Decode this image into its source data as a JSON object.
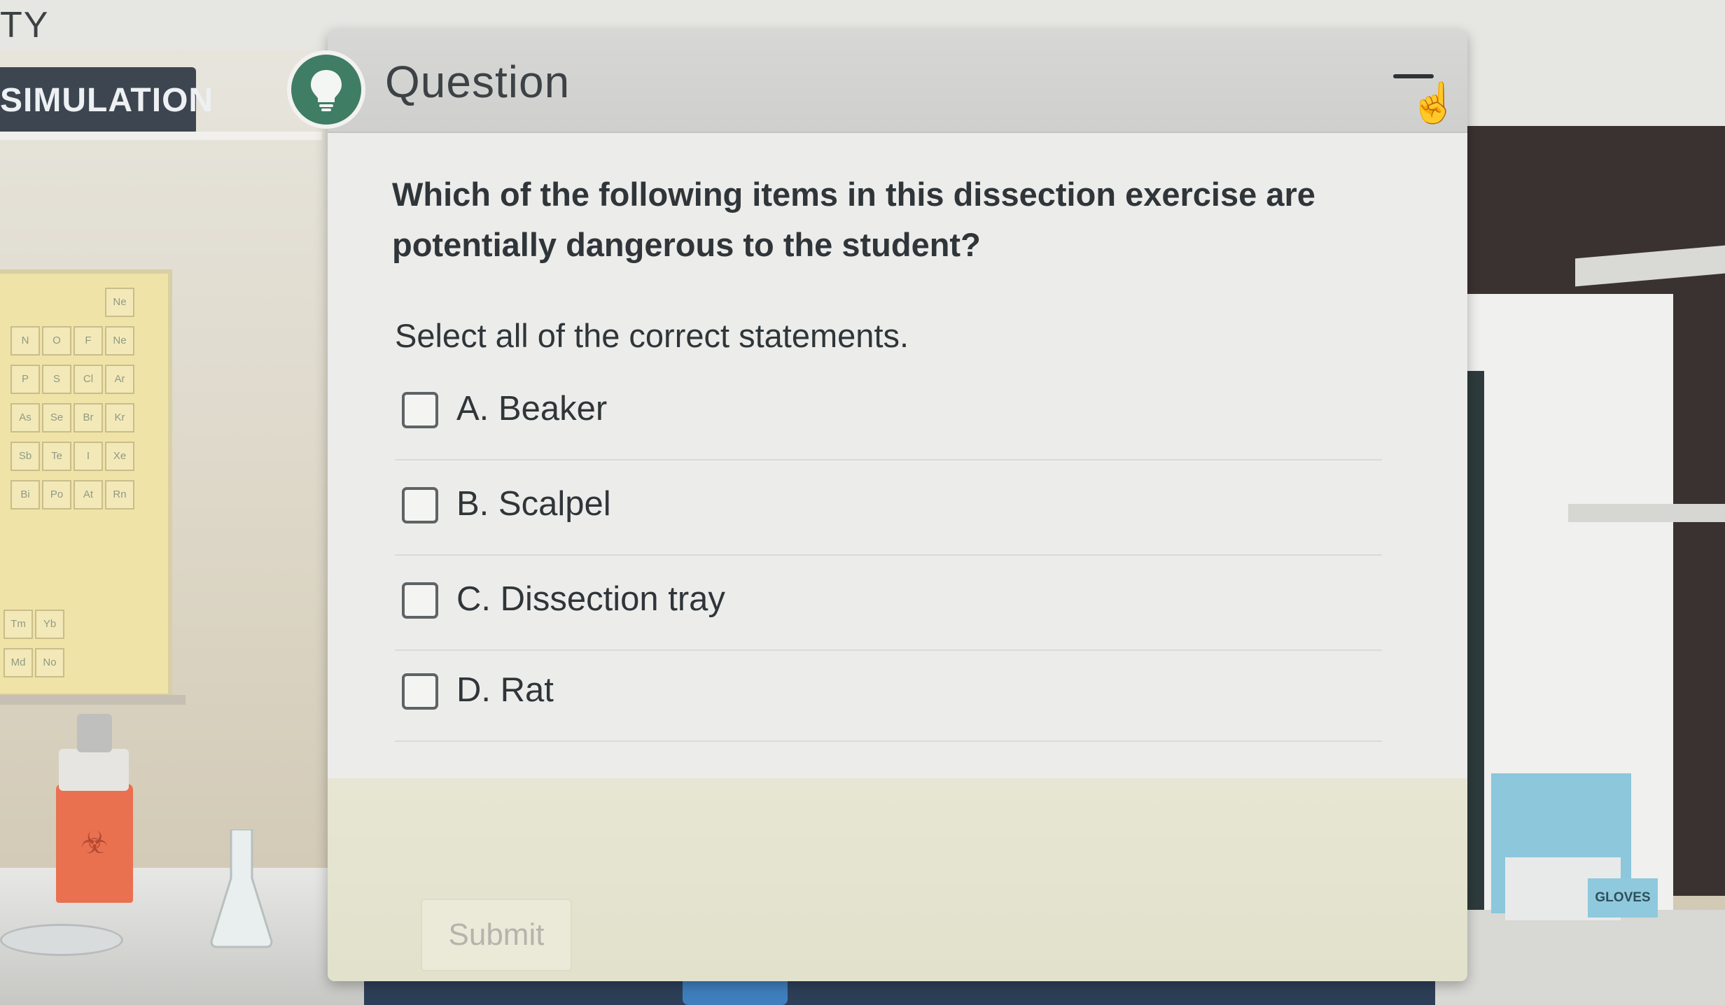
{
  "top_left_text": "TY",
  "simulation_label": "SIMULATION",
  "dialog": {
    "title": "Question",
    "minimize_label": "—",
    "question": "Which of the following items in this dissection exercise are potentially dangerous to the student?",
    "instruction": "Select all of the correct statements.",
    "options": [
      {
        "label": "A. Beaker",
        "checked": false
      },
      {
        "label": "B. Scalpel",
        "checked": false
      },
      {
        "label": "C. Dissection tray",
        "checked": false
      },
      {
        "label": "D. Rat",
        "checked": false
      }
    ],
    "submit_label": "Submit"
  },
  "background": {
    "gloves_label": "GLOVES",
    "periodic_cells": [
      "Ne",
      "N",
      "O",
      "F",
      "Ne",
      "P",
      "S",
      "Cl",
      "Ar",
      "As",
      "Se",
      "Br",
      "Kr",
      "Sb",
      "Te",
      "I",
      "Xe",
      "Bi",
      "Po",
      "At",
      "Rn",
      "Tm",
      "Yb",
      "Md",
      "No"
    ]
  },
  "colors": {
    "badge": "#3f7d64",
    "sim_label_bg": "#3d4650",
    "dialog_bg": "#ececeb"
  }
}
